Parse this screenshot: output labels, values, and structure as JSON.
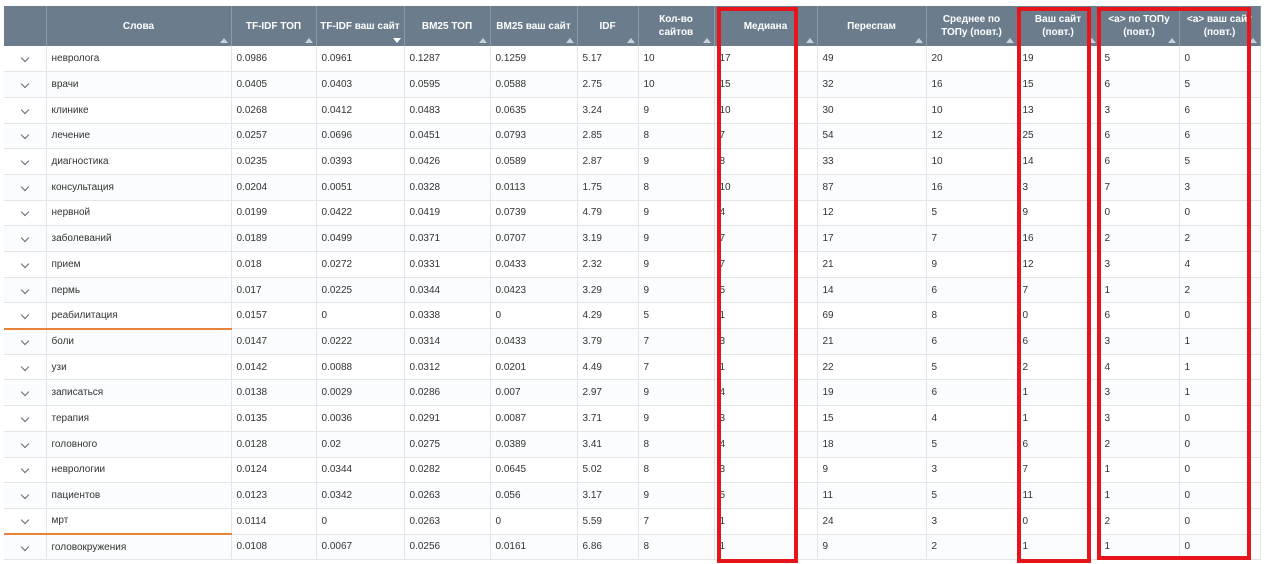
{
  "columns": [
    {
      "key": "expand",
      "label": ""
    },
    {
      "key": "word",
      "label": "Слова"
    },
    {
      "key": "tfidf_top",
      "label": "TF-IDF ТОП"
    },
    {
      "key": "tfidf_site",
      "label": "TF-IDF ваш сайт"
    },
    {
      "key": "bm25_top",
      "label": "BM25 ТОП"
    },
    {
      "key": "bm25_site",
      "label": "BM25 ваш сайт"
    },
    {
      "key": "idf",
      "label": "IDF"
    },
    {
      "key": "sites",
      "label": "Кол-во сайтов"
    },
    {
      "key": "median",
      "label": "Медиана"
    },
    {
      "key": "overspam",
      "label": "Переспам"
    },
    {
      "key": "avg_top",
      "label": "Среднее по ТОПу (повт.)"
    },
    {
      "key": "your_site",
      "label": "Ваш сайт (повт.)"
    },
    {
      "key": "a_top",
      "label": "<a> по ТОПу (повт.)"
    },
    {
      "key": "a_site",
      "label": "<a> ваш сайт (повт.)"
    }
  ],
  "rows": [
    [
      "",
      "невролога",
      "0.0986",
      "0.0961",
      "0.1287",
      "0.1259",
      "5.17",
      "10",
      "17",
      "49",
      "20",
      "19",
      "5",
      "0"
    ],
    [
      "",
      "врачи",
      "0.0405",
      "0.0403",
      "0.0595",
      "0.0588",
      "2.75",
      "10",
      "15",
      "32",
      "16",
      "15",
      "6",
      "5"
    ],
    [
      "",
      "клинике",
      "0.0268",
      "0.0412",
      "0.0483",
      "0.0635",
      "3.24",
      "9",
      "10",
      "30",
      "10",
      "13",
      "3",
      "6"
    ],
    [
      "",
      "лечение",
      "0.0257",
      "0.0696",
      "0.0451",
      "0.0793",
      "2.85",
      "8",
      "7",
      "54",
      "12",
      "25",
      "6",
      "6"
    ],
    [
      "",
      "диагностика",
      "0.0235",
      "0.0393",
      "0.0426",
      "0.0589",
      "2.87",
      "9",
      "8",
      "33",
      "10",
      "14",
      "6",
      "5"
    ],
    [
      "",
      "консультация",
      "0.0204",
      "0.0051",
      "0.0328",
      "0.0113",
      "1.75",
      "8",
      "10",
      "87",
      "16",
      "3",
      "7",
      "3"
    ],
    [
      "",
      "нервной",
      "0.0199",
      "0.0422",
      "0.0419",
      "0.0739",
      "4.79",
      "9",
      "4",
      "12",
      "5",
      "9",
      "0",
      "0"
    ],
    [
      "",
      "заболеваний",
      "0.0189",
      "0.0499",
      "0.0371",
      "0.0707",
      "3.19",
      "9",
      "7",
      "17",
      "7",
      "16",
      "2",
      "2"
    ],
    [
      "",
      "прием",
      "0.018",
      "0.0272",
      "0.0331",
      "0.0433",
      "2.32",
      "9",
      "7",
      "21",
      "9",
      "12",
      "3",
      "4"
    ],
    [
      "",
      "пермь",
      "0.017",
      "0.0225",
      "0.0344",
      "0.0423",
      "3.29",
      "9",
      "5",
      "14",
      "6",
      "7",
      "1",
      "2"
    ],
    [
      "",
      "реабилитация",
      "0.0157",
      "0",
      "0.0338",
      "0",
      "4.29",
      "5",
      "1",
      "69",
      "8",
      "0",
      "6",
      "0"
    ],
    [
      "",
      "боли",
      "0.0147",
      "0.0222",
      "0.0314",
      "0.0433",
      "3.79",
      "7",
      "3",
      "21",
      "6",
      "6",
      "3",
      "1"
    ],
    [
      "",
      "узи",
      "0.0142",
      "0.0088",
      "0.0312",
      "0.0201",
      "4.49",
      "7",
      "1",
      "22",
      "5",
      "2",
      "4",
      "1"
    ],
    [
      "",
      "записаться",
      "0.0138",
      "0.0029",
      "0.0286",
      "0.007",
      "2.97",
      "9",
      "4",
      "19",
      "6",
      "1",
      "3",
      "1"
    ],
    [
      "",
      "терапия",
      "0.0135",
      "0.0036",
      "0.0291",
      "0.0087",
      "3.71",
      "9",
      "3",
      "15",
      "4",
      "1",
      "3",
      "0"
    ],
    [
      "",
      "головного",
      "0.0128",
      "0.02",
      "0.0275",
      "0.0389",
      "3.41",
      "8",
      "4",
      "18",
      "5",
      "6",
      "2",
      "0"
    ],
    [
      "",
      "неврологии",
      "0.0124",
      "0.0344",
      "0.0282",
      "0.0645",
      "5.02",
      "8",
      "3",
      "9",
      "3",
      "7",
      "1",
      "0"
    ],
    [
      "",
      "пациентов",
      "0.0123",
      "0.0342",
      "0.0263",
      "0.056",
      "3.17",
      "9",
      "5",
      "11",
      "5",
      "11",
      "1",
      "0"
    ],
    [
      "",
      "мрт",
      "0.0114",
      "0",
      "0.0263",
      "0",
      "5.59",
      "7",
      "1",
      "24",
      "3",
      "0",
      "2",
      "0"
    ],
    [
      "",
      "головокружения",
      "0.0108",
      "0.0067",
      "0.0256",
      "0.0161",
      "6.86",
      "8",
      "1",
      "9",
      "2",
      "1",
      "1",
      "0"
    ]
  ],
  "highlighted_rows": [
    10,
    18
  ],
  "sorted_column": "tfidf_site",
  "colors": {
    "header_bg": "#6b7d8c",
    "highlight_line": "#e8823a",
    "annotation_box": "#e8141c"
  }
}
